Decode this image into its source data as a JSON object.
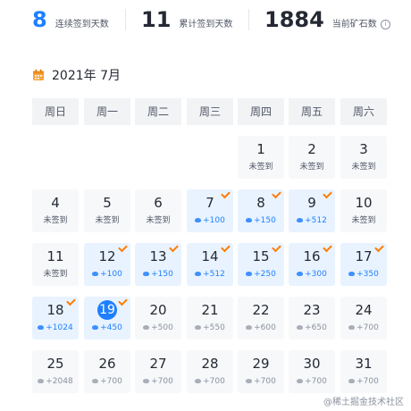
{
  "stats": {
    "continuous": {
      "value": "8",
      "label": "连续签到天数"
    },
    "total": {
      "value": "11",
      "label": "累计签到天数"
    },
    "ore": {
      "value": "1884",
      "label": "当前矿石数",
      "info_icon": "i"
    }
  },
  "calendar": {
    "title": "2021年 7月",
    "weekdays": [
      "周日",
      "周一",
      "周二",
      "周三",
      "周四",
      "周五",
      "周六"
    ],
    "days": [
      {
        "day": "1",
        "text": "未签到",
        "state": "none"
      },
      {
        "day": "2",
        "text": "未签到",
        "state": "none"
      },
      {
        "day": "3",
        "text": "未签到",
        "state": "none"
      },
      {
        "day": "4",
        "text": "未签到",
        "state": "none"
      },
      {
        "day": "5",
        "text": "未签到",
        "state": "none"
      },
      {
        "day": "6",
        "text": "未签到",
        "state": "none"
      },
      {
        "day": "7",
        "text": "+100",
        "state": "signed"
      },
      {
        "day": "8",
        "text": "+150",
        "state": "signed"
      },
      {
        "day": "9",
        "text": "+512",
        "state": "signed"
      },
      {
        "day": "10",
        "text": "未签到",
        "state": "none"
      },
      {
        "day": "11",
        "text": "未签到",
        "state": "none"
      },
      {
        "day": "12",
        "text": "+100",
        "state": "signed"
      },
      {
        "day": "13",
        "text": "+150",
        "state": "signed"
      },
      {
        "day": "14",
        "text": "+512",
        "state": "signed"
      },
      {
        "day": "15",
        "text": "+250",
        "state": "signed"
      },
      {
        "day": "16",
        "text": "+300",
        "state": "signed"
      },
      {
        "day": "17",
        "text": "+350",
        "state": "signed"
      },
      {
        "day": "18",
        "text": "+1024",
        "state": "signed"
      },
      {
        "day": "19",
        "text": "+450",
        "state": "today"
      },
      {
        "day": "20",
        "text": "+500",
        "state": "future"
      },
      {
        "day": "21",
        "text": "+550",
        "state": "future"
      },
      {
        "day": "22",
        "text": "+600",
        "state": "future"
      },
      {
        "day": "23",
        "text": "+650",
        "state": "future"
      },
      {
        "day": "24",
        "text": "+700",
        "state": "future"
      },
      {
        "day": "25",
        "text": "+2048",
        "state": "future"
      },
      {
        "day": "26",
        "text": "+700",
        "state": "future"
      },
      {
        "day": "27",
        "text": "+700",
        "state": "future"
      },
      {
        "day": "28",
        "text": "+700",
        "state": "future"
      },
      {
        "day": "29",
        "text": "+700",
        "state": "future"
      },
      {
        "day": "30",
        "text": "+700",
        "state": "future"
      },
      {
        "day": "31",
        "text": "+700",
        "state": "future"
      }
    ]
  },
  "watermark": "@稀土掘金技术社区",
  "colors": {
    "accent": "#1e80ff",
    "check": "#ff7d00",
    "calendar_icon": "#f7a541"
  },
  "icons": {
    "calendar": "calendar-icon",
    "check": "check-icon",
    "ore": "ore-icon"
  }
}
